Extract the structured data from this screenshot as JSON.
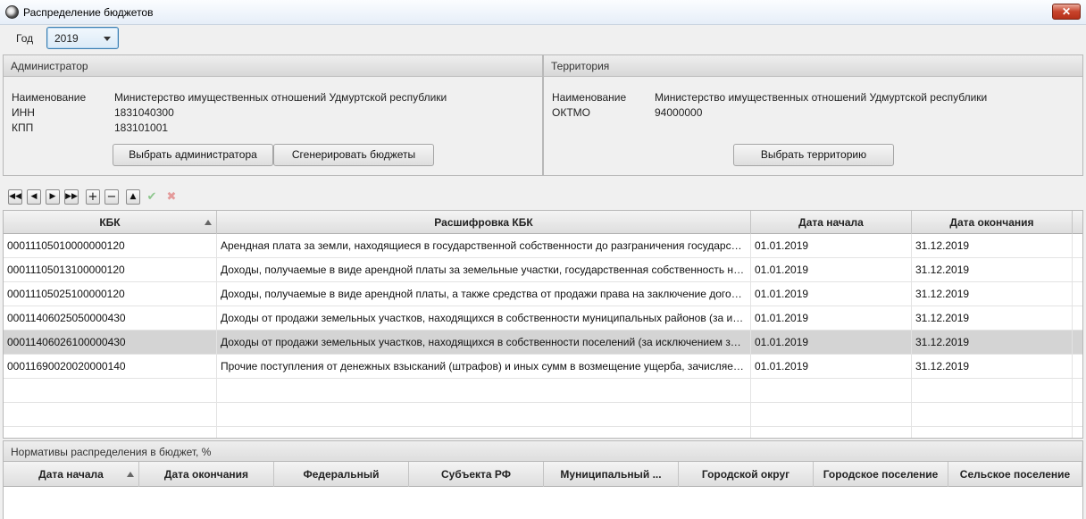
{
  "window": {
    "title": "Распределение бюджетов",
    "close_label": "✕"
  },
  "year": {
    "label": "Год",
    "value": "2019"
  },
  "administrator": {
    "header": "Администратор",
    "name_label": "Наименование",
    "name_value": "Министерство имущественных отношений Удмуртской республики",
    "inn_label": "ИНН",
    "inn_value": "1831040300",
    "kpp_label": "КПП",
    "kpp_value": "183101001",
    "select_button": "Выбрать администратора",
    "generate_button": "Сгенерировать бюджеты"
  },
  "territory": {
    "header": "Территория",
    "name_label": "Наименование",
    "name_value": "Министерство имущественных отношений Удмуртской республики",
    "oktmo_label": "ОКТМО",
    "oktmo_value": "94000000",
    "select_button": "Выбрать территорию"
  },
  "toolbar": {
    "first": "◀◀",
    "prev": "◀",
    "next": "▶",
    "last": "▶▶",
    "add": "+",
    "remove": "−",
    "up": "▲",
    "confirm": "✔",
    "cancel": "✖"
  },
  "grid": {
    "columns": [
      "КБК",
      "Расшифровка КБК",
      "Дата начала",
      "Дата окончания"
    ],
    "rows": [
      {
        "kbk": "00011105010000000120",
        "desc": "Арендная плата за земли, находящиеся в государственной собственности до разграничения государстве...",
        "start": "01.01.2019",
        "end": "31.12.2019"
      },
      {
        "kbk": "00011105013100000120",
        "desc": "Доходы, получаемые в виде арендной платы за земельные участки, государственная собственность на к...",
        "start": "01.01.2019",
        "end": "31.12.2019"
      },
      {
        "kbk": "00011105025100000120",
        "desc": "Доходы, получаемые в виде арендной платы, а также средства от продажи права на заключение догово...",
        "start": "01.01.2019",
        "end": "31.12.2019"
      },
      {
        "kbk": "00011406025050000430",
        "desc": "Доходы от продажи земельных участков, находящихся в собственности муниципальных районов (за иск...",
        "start": "01.01.2019",
        "end": "31.12.2019"
      },
      {
        "kbk": "00011406026100000430",
        "desc": "Доходы от продажи земельных участков, находящихся в собственности поселений (за исключением зем...",
        "start": "01.01.2019",
        "end": "31.12.2019"
      },
      {
        "kbk": "00011690020020000140",
        "desc": "Прочие поступления от денежных взысканий (штрафов) и иных сумм в возмещение ущерба, зачисляем...",
        "start": "01.01.2019",
        "end": "31.12.2019"
      }
    ]
  },
  "norms": {
    "header": "Нормативы распределения в бюджет, %",
    "columns": [
      "Дата начала",
      "Дата окончания",
      "Федеральный",
      "Субъекта РФ",
      "Муниципальный ...",
      "Городской округ",
      "Городское поселение",
      "Сельское поселение"
    ]
  }
}
